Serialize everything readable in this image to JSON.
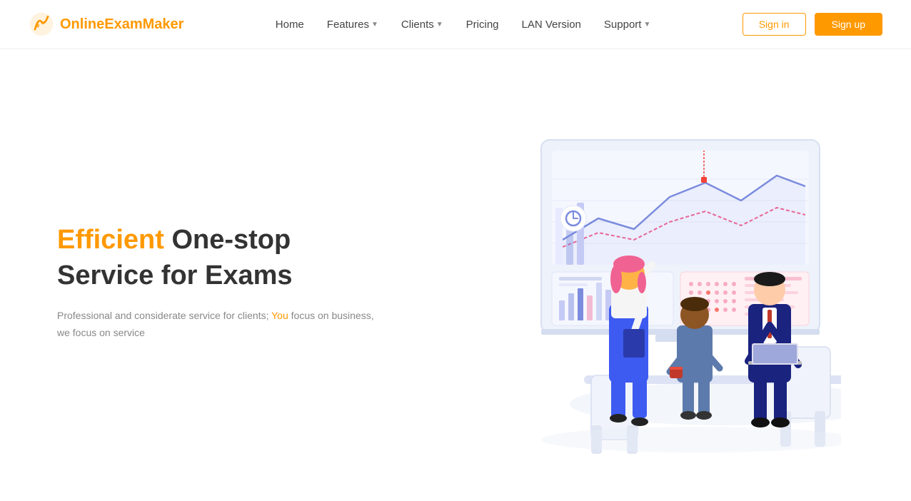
{
  "logo": {
    "text": "OnlineExamMaker"
  },
  "nav": {
    "links": [
      {
        "label": "Home",
        "has_dropdown": false
      },
      {
        "label": "Features",
        "has_dropdown": true
      },
      {
        "label": "Clients",
        "has_dropdown": true
      },
      {
        "label": "Pricing",
        "has_dropdown": false
      },
      {
        "label": "LAN Version",
        "has_dropdown": false
      },
      {
        "label": "Support",
        "has_dropdown": true
      }
    ],
    "signin_label": "Sign in",
    "signup_label": "Sign up"
  },
  "hero": {
    "title_highlight": "Efficient",
    "title_rest": " One-stop Service for Exams",
    "desc_line1": "Professional and considerate service for clients; ",
    "desc_you": "You",
    "desc_line2": " focus on business, we focus on service"
  }
}
